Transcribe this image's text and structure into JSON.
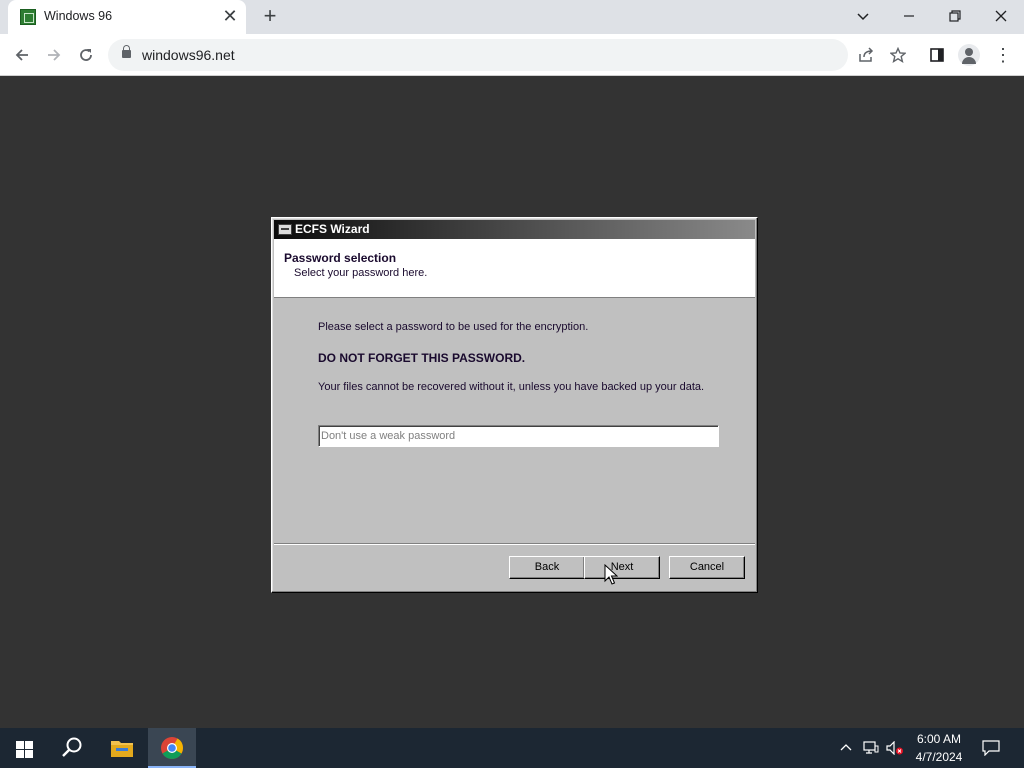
{
  "browser": {
    "tab_title": "Windows 96",
    "url": "windows96.net",
    "tab_close_glyph": "✕",
    "new_tab_glyph": "+",
    "menu_glyph": "⋮"
  },
  "wizard": {
    "window_title": "ECFS Wizard",
    "header_title": "Password selection",
    "header_subtitle": "Select your password here.",
    "line1": "Please select a password to be used for the encryption.",
    "warning": "DO NOT FORGET THIS PASSWORD.",
    "line2": "Your files cannot be recovered without it, unless you have backed up your data.",
    "password_value": "",
    "password_placeholder": "Don't use a weak password",
    "back_label": "Back",
    "next_label": "Next",
    "cancel_label": "Cancel"
  },
  "taskbar": {
    "time": "6:00 AM",
    "date": "4/7/2024"
  },
  "icons": {
    "favicon": "windows96-favicon",
    "back": "arrow-left-icon",
    "forward": "arrow-right-icon",
    "reload": "reload-icon",
    "lock": "lock-icon",
    "share": "share-icon",
    "bookmark": "star-icon",
    "sidepanel": "side-panel-icon",
    "profile": "profile-icon",
    "start": "windows-logo-icon",
    "search": "search-icon",
    "explorer": "folder-icon",
    "chrome": "chrome-icon"
  },
  "colors": {
    "desktop_bg": "#333333",
    "dialog_face": "#c0c0c0",
    "text_dark": "#1a0a2e",
    "taskbar_bg": "#1c2733"
  }
}
